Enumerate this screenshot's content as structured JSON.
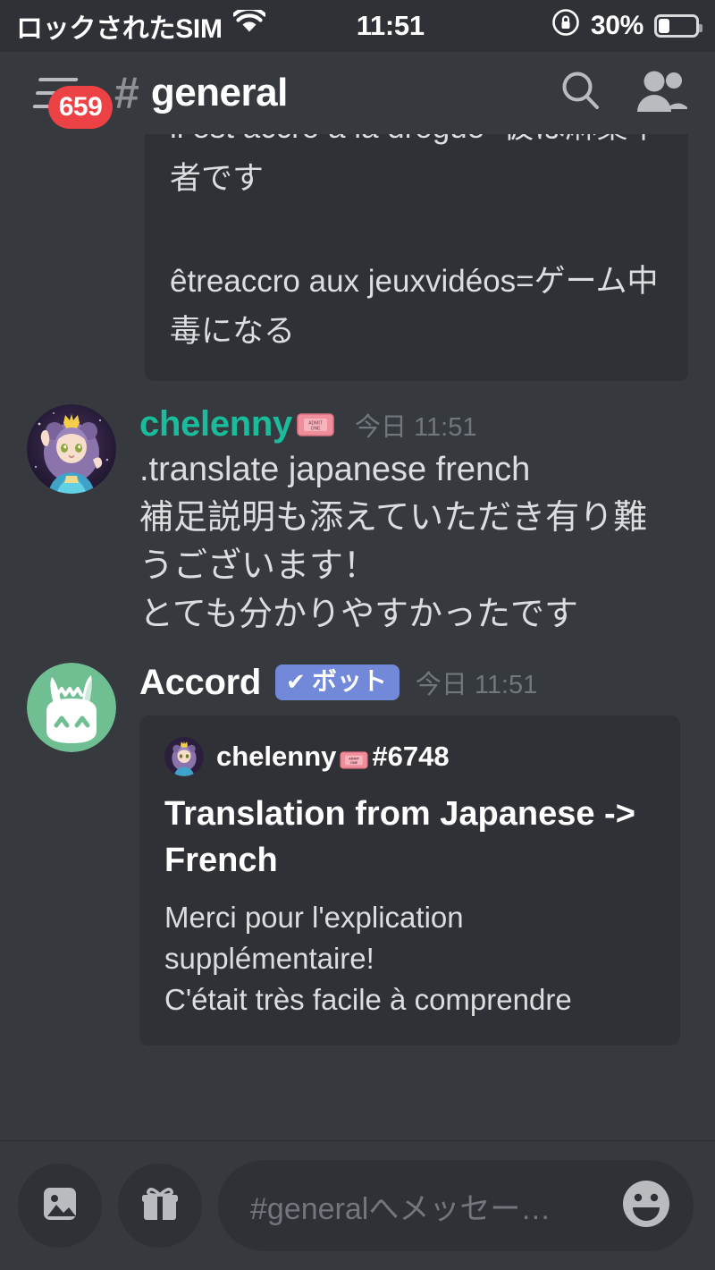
{
  "status_bar": {
    "carrier": "ロックされたSIM",
    "wifi_icon": "wifi-icon",
    "clock": "11:51",
    "orientation_lock_icon": "rotation-lock-icon",
    "battery_percent": "30%",
    "battery_level": 30
  },
  "header": {
    "menu_icon": "hamburger-menu-icon",
    "mention_count": "659",
    "channel_hash": "#",
    "channel_name": "general",
    "search_icon": "search-icon",
    "members_icon": "members-icon"
  },
  "top_embed": {
    "cut_line": "il est accro à la drogue=彼は麻薬中毒",
    "line2": "者です",
    "line3": "êtreaccro aux jeuxvidéos=ゲーム中",
    "line4": "毒になる"
  },
  "messages": [
    {
      "author": "chelenny",
      "author_color": "#1abc9c",
      "author_badge_emoji": "ticket-emoji",
      "timestamp": "今日 11:51",
      "timestamp_day": "今日",
      "timestamp_time": "11:51",
      "avatar_name": "chelenny-avatar",
      "lines": [
        ".translate japanese french",
        "補足説明も添えていただき有り難",
        "うございます！",
        "とても分かりやすかったです"
      ]
    },
    {
      "author": "Accord",
      "author_color": "#ffffff",
      "bot_tag": "ボット",
      "bot_tag_check": "✔",
      "bot_tag_color": "#7289da",
      "timestamp": "今日 11:51",
      "avatar_name": "accord-bot-avatar",
      "embed": {
        "author_name": "chelenny",
        "author_badge_emoji": "ticket-emoji",
        "author_discriminator": "#6748",
        "title": "Translation from Japanese -> French",
        "description_line1": "Merci pour l'explication",
        "description_line2": "supplémentaire!",
        "description_line3": "C'était très facile à comprendre"
      }
    }
  ],
  "input_bar": {
    "image_icon": "image-attachment-icon",
    "gift_icon": "gift-nitro-icon",
    "placeholder": "#generalへメッセー…",
    "emoji_icon": "emoji-picker-icon"
  },
  "colors": {
    "background": "#36393e",
    "surface": "#2f3136",
    "text": "#dcddde",
    "muted": "#72767d",
    "accent_teal": "#1abc9c",
    "blurple": "#7289da",
    "red_badge": "#ed4245",
    "bot_avatar_green": "#6fbf93"
  }
}
